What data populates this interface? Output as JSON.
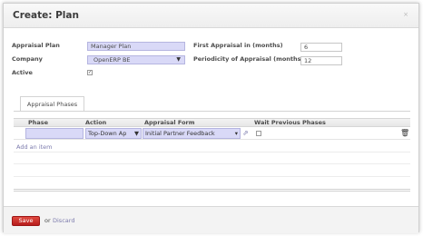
{
  "dialog": {
    "title": "Create: Plan",
    "close_label": "×"
  },
  "form": {
    "appraisal_plan_label": "Appraisal Plan",
    "appraisal_plan_value": "Manager Plan",
    "company_label": "Company",
    "company_value": "OpenERP BE",
    "active_label": "Active",
    "active_checked": true,
    "first_appraisal_label": "First Appraisal in (months)",
    "first_appraisal_value": "6",
    "periodicity_label": "Periodicity of Appraisal (months)",
    "periodicity_value": "12"
  },
  "tabs": [
    {
      "label": "Appraisal Phases"
    }
  ],
  "grid": {
    "columns": [
      "Phase",
      "Action",
      "Appraisal Form",
      "Wait Previous Phases"
    ],
    "rows": [
      {
        "phase": "",
        "action": "Top-Down Ap",
        "appraisal_form": "Initial Partner Feedback",
        "wait_previous": false
      }
    ],
    "add_item_label": "Add an item"
  },
  "footer": {
    "save_label": "Save",
    "or_label": "or",
    "discard_label": "Discard"
  },
  "colors": {
    "required_field": "#d9d9f7",
    "save_button": "#c72a25",
    "link": "#7c7bad"
  }
}
